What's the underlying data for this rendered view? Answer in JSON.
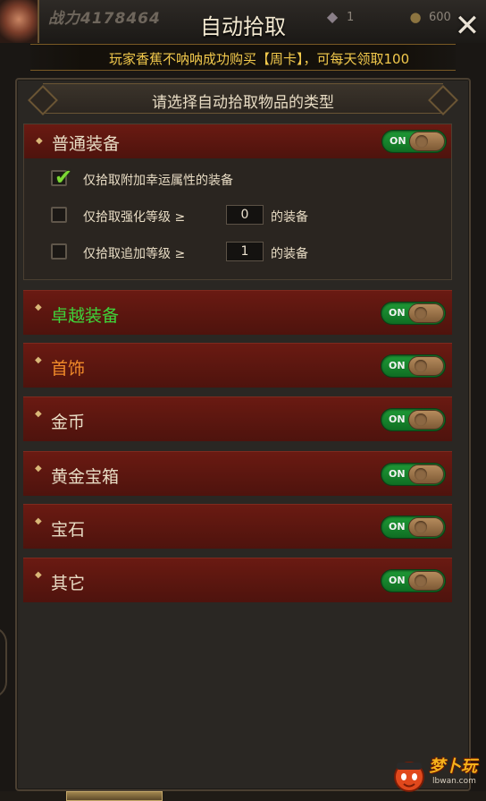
{
  "topbar": {
    "power_text": "战力4178464",
    "gem_icon": "gem-icon",
    "gem_count": "1",
    "gold_icon": "gold-icon",
    "gold_count": "600"
  },
  "dialog": {
    "title": "自动拾取",
    "close_icon": "close-icon",
    "marquee": "玩家香蕉不呐呐成功购买【周卡】，可每天领取100",
    "panel_header": "请选择自动拾取物品的类型"
  },
  "categories": [
    {
      "label": "普通装备",
      "color": "#e8dcc4",
      "toggle": "ON",
      "expanded": true,
      "options": [
        {
          "checked": true,
          "text": "仅拾取附加幸运属性的装备"
        },
        {
          "checked": false,
          "text": "仅拾取强化等级 ≥",
          "value": "0",
          "suffix": "的装备"
        },
        {
          "checked": false,
          "text": "仅拾取追加等级 ≥",
          "value": "1",
          "suffix": "的装备"
        }
      ]
    },
    {
      "label": "卓越装备",
      "color": "#3fd43a",
      "toggle": "ON"
    },
    {
      "label": "首饰",
      "color": "#f08a2a",
      "toggle": "ON"
    },
    {
      "label": "金币",
      "color": "#e8dcc4",
      "toggle": "ON"
    },
    {
      "label": "黄金宝箱",
      "color": "#e8dcc4",
      "toggle": "ON"
    },
    {
      "label": "宝石",
      "color": "#e8dcc4",
      "toggle": "ON"
    },
    {
      "label": "其它",
      "color": "#e8dcc4",
      "toggle": "ON"
    }
  ],
  "watermark": {
    "logo_text": "梦卜玩",
    "url": "lbwan.com"
  },
  "colors": {
    "toggle_on": "#1f9a36",
    "category_bg": "#5c160f",
    "accent_gold": "#f2c94c"
  }
}
